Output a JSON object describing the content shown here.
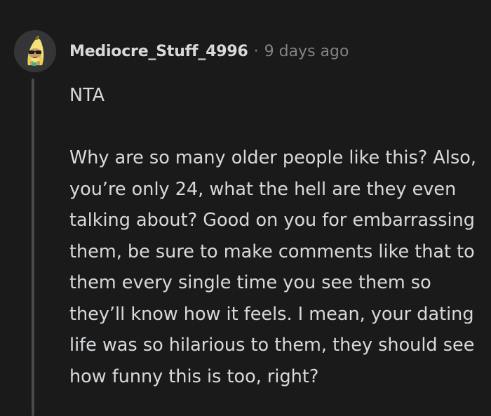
{
  "comment": {
    "author": "Mediocre_Stuff_4996",
    "separator": "·",
    "timestamp": "9 days ago",
    "avatar_icon": "banana-avatar-icon",
    "paragraphs": [
      "NTA",
      "Why are so many older people like this? Also, you’re only 24, what the hell are they even talking about? Good on you for embarrassing them, be sure to make comments like that to them every single time you see them so they’ll know how it feels. I mean, your dating life was so hilarious to them, they should see how funny this is too, right?"
    ]
  },
  "colors": {
    "background": "#1a1a1b",
    "text": "#d7dadc",
    "meta": "#818384",
    "thread_line": "#4a4a4c"
  }
}
